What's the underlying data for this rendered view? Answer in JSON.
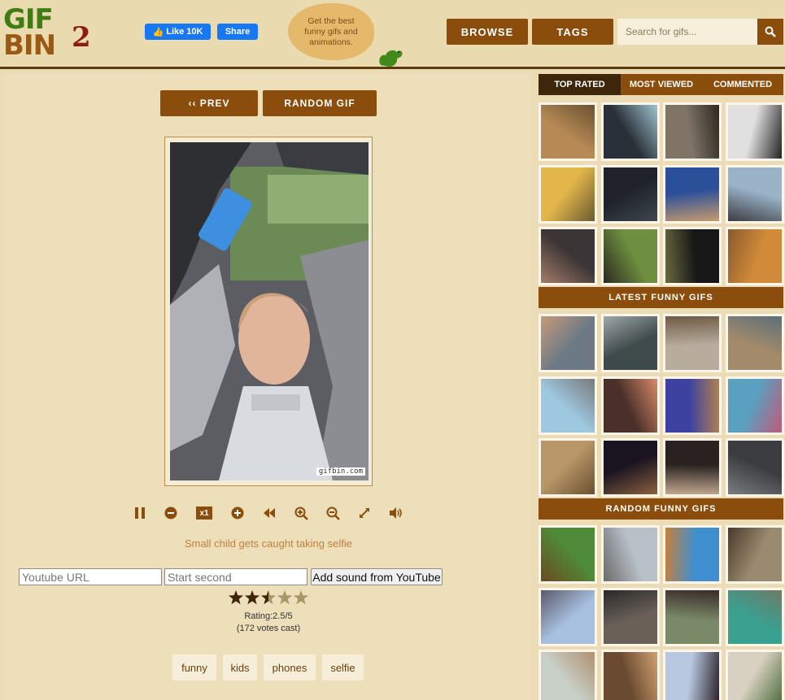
{
  "header": {
    "logo_gif": "GIF",
    "logo_bin": "BIN",
    "logo_two": "2",
    "fb_like": "Like 10K",
    "fb_share": "Share",
    "tagline": "Get the best funny gifs and animations.",
    "browse": "BROWSE",
    "tags": "TAGS",
    "search_placeholder": "Search for gifs..."
  },
  "main": {
    "prev": "‹‹ PREV",
    "random": "RANDOM GIF",
    "watermark": "gifbin.com",
    "speed": "x1",
    "caption": "Small child gets caught taking selfie",
    "youtube_placeholder": "Youtube URL",
    "start_placeholder": "Start second",
    "add_sound": "Add sound from YouTube",
    "rating_value": 2.5,
    "rating_max": 5,
    "rating_text": "Rating:2.5/5",
    "votes_text": "(172 votes cast)",
    "tags": [
      "funny",
      "kids",
      "phones",
      "selfie"
    ]
  },
  "sidebar": {
    "tabs": [
      "TOP RATED",
      "MOST VIEWED",
      "COMMENTED"
    ],
    "latest_title": "LATEST FUNNY GIFS",
    "random_title": "RANDOM FUNNY GIFS"
  },
  "colors": {
    "accent": "#8b4d0b",
    "accent_dark": "#3d2609",
    "background": "#ebdcb6"
  }
}
